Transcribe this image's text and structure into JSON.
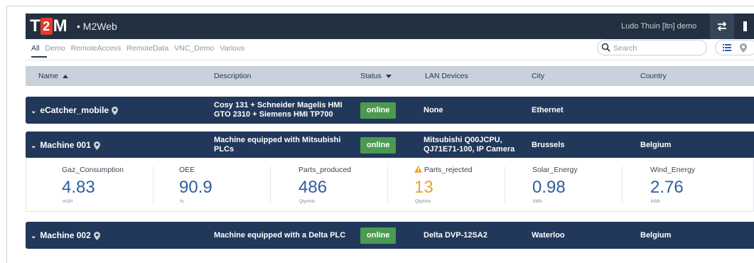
{
  "header": {
    "logo_t": "T",
    "logo_2": "2",
    "logo_m": "M",
    "app_name": "• M2Web",
    "user": "Ludo Thuin [ltn] demo",
    "swap_icon": "swap-arrows-icon",
    "bg_color": "#22303f"
  },
  "tabs": [
    {
      "label": "All",
      "active": true
    },
    {
      "label": "Demo"
    },
    {
      "label": "RemoteAccess"
    },
    {
      "label": "RemoteData"
    },
    {
      "label": "VNC_Demo"
    },
    {
      "label": "Various"
    }
  ],
  "search": {
    "placeholder": "Search",
    "icon": "search-icon"
  },
  "table": {
    "headers": {
      "name": "Name",
      "description": "Description",
      "status": "Status",
      "lan_devices": "LAN Devices",
      "city": "City",
      "country": "Country"
    },
    "sort": {
      "name": "ascending",
      "status": "descending"
    }
  },
  "rows": [
    {
      "name": "eCatcher_mobile",
      "description_line1": "Cosy 131 + Schneider Magelis HMI",
      "description_line2": "GTO 2310 + Siemens HMI TP700",
      "status": "online",
      "lan_devices_line1": "None",
      "lan_devices_line2": "",
      "city": "Ethernet",
      "country": ""
    },
    {
      "name": "Machine 001",
      "description_line1": "Machine equipped with Mitsubishi",
      "description_line2": "PLCs",
      "status": "online",
      "lan_devices_line1": "Mitsubishi Q00JCPU,",
      "lan_devices_line2": "QJ71E71-100, IP Camera",
      "city": "Brussels",
      "country": "Belgium"
    },
    {
      "name": "Machine 002",
      "description_line1": "Machine equipped with a Delta PLC",
      "description_line2": "",
      "status": "online",
      "lan_devices_line1": "Delta DVP-12SA2",
      "lan_devices_line2": "",
      "city": "Waterloo",
      "country": "Belgium"
    }
  ],
  "metrics": [
    {
      "label": "Gaz_Consumption",
      "value": "4.83",
      "unit": "m3/h"
    },
    {
      "label": "OEE",
      "value": "90.9",
      "unit": "%"
    },
    {
      "label": "Parts_produced",
      "value": "486",
      "unit": "Qty/min"
    },
    {
      "label": "Parts_rejected",
      "value": "13",
      "unit": "Qty/min",
      "warning": true
    },
    {
      "label": "Solar_Energy",
      "value": "0.98",
      "unit": "kWh"
    },
    {
      "label": "Wind_Energy",
      "value": "2.76",
      "unit": "kWh"
    }
  ],
  "colors": {
    "row_bg": "#22385a",
    "status_online": "#4b9a4f",
    "metric_value": "#2e5d9e",
    "warning": "#f0a030"
  }
}
